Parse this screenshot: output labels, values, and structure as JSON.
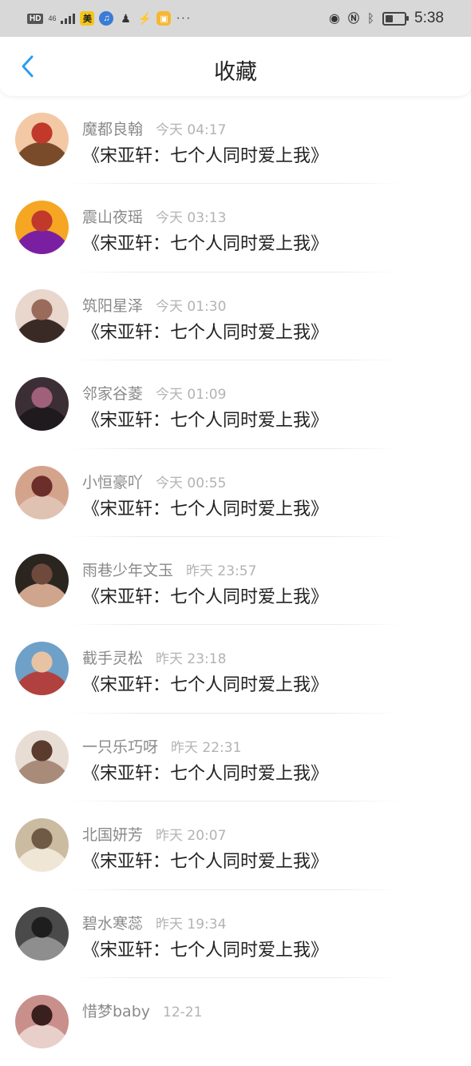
{
  "status_bar": {
    "hd": "HD",
    "network": "46",
    "app_badge": "美",
    "dots": "···",
    "time": "5:38",
    "battery_level": 0.4
  },
  "header": {
    "title": "收藏",
    "back_icon": "chevron-left-icon"
  },
  "colors": {
    "accent": "#2a9df4",
    "name_gray": "#8a8a8a",
    "time_gray": "#b3b3b3"
  },
  "items": [
    {
      "name": "魔都良翰",
      "time": "今天 04:17",
      "content": "《宋亚轩：七个人同时爱上我》"
    },
    {
      "name": "震山夜瑶",
      "time": "今天 03:13",
      "content": "《宋亚轩：七个人同时爱上我》"
    },
    {
      "name": "筑阳星泽",
      "time": "今天 01:30",
      "content": "《宋亚轩：七个人同时爱上我》"
    },
    {
      "name": "邻家谷菱",
      "time": "今天 01:09",
      "content": "《宋亚轩：七个人同时爱上我》"
    },
    {
      "name": "小恒豪吖",
      "time": "今天 00:55",
      "content": "《宋亚轩：七个人同时爱上我》"
    },
    {
      "name": "雨巷少年文玉",
      "time": "昨天 23:57",
      "content": "《宋亚轩：七个人同时爱上我》"
    },
    {
      "name": "截手灵松",
      "time": "昨天 23:18",
      "content": "《宋亚轩：七个人同时爱上我》"
    },
    {
      "name": "一只乐巧呀",
      "time": "昨天 22:31",
      "content": "《宋亚轩：七个人同时爱上我》"
    },
    {
      "name": "北国妍芳",
      "time": "昨天 20:07",
      "content": "《宋亚轩：七个人同时爱上我》"
    },
    {
      "name": "碧水寒蕊",
      "time": "昨天 19:34",
      "content": "《宋亚轩：七个人同时爱上我》"
    },
    {
      "name": "惜梦baby",
      "time": "12-21",
      "content": ""
    }
  ]
}
